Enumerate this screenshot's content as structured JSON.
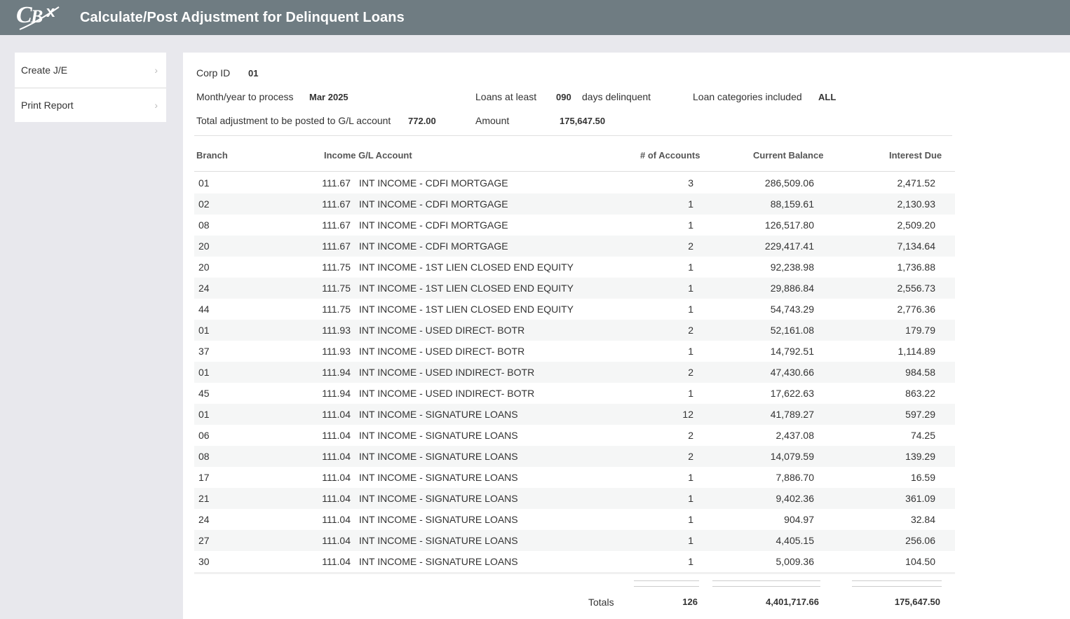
{
  "header": {
    "title": "Calculate/Post Adjustment for Delinquent Loans",
    "logo_icon": "cbx-logo"
  },
  "sidebar": {
    "items": [
      {
        "label": "Create J/E"
      },
      {
        "label": "Print Report"
      }
    ]
  },
  "info": {
    "corp_id_label": "Corp ID",
    "corp_id": "01",
    "month_label": "Month/year to process",
    "month": "Mar 2025",
    "loans_label": "Loans at least",
    "loans_days": "090",
    "days_label": "days delinquent",
    "categories_label": "Loan categories included",
    "categories": "ALL",
    "total_adj_label": "Total adjustment to be posted to G/L account",
    "total_adj": "772.00",
    "amount_label": "Amount",
    "amount": "175,647.50"
  },
  "table": {
    "headers": {
      "branch": "Branch",
      "gl": "Income G/L Account",
      "accounts": "# of Accounts",
      "balance": "Current Balance",
      "interest": "Interest Due"
    },
    "rows": [
      {
        "branch": "01",
        "gl": "111.67",
        "desc": "INT INCOME - CDFI MORTGAGE",
        "accounts": "3",
        "balance": "286,509.06",
        "interest": "2,471.52"
      },
      {
        "branch": "02",
        "gl": "111.67",
        "desc": "INT INCOME - CDFI MORTGAGE",
        "accounts": "1",
        "balance": "88,159.61",
        "interest": "2,130.93"
      },
      {
        "branch": "08",
        "gl": "111.67",
        "desc": "INT INCOME - CDFI MORTGAGE",
        "accounts": "1",
        "balance": "126,517.80",
        "interest": "2,509.20"
      },
      {
        "branch": "20",
        "gl": "111.67",
        "desc": "INT INCOME - CDFI MORTGAGE",
        "accounts": "2",
        "balance": "229,417.41",
        "interest": "7,134.64"
      },
      {
        "branch": "20",
        "gl": "111.75",
        "desc": "INT INCOME - 1ST LIEN CLOSED END EQUITY",
        "accounts": "1",
        "balance": "92,238.98",
        "interest": "1,736.88"
      },
      {
        "branch": "24",
        "gl": "111.75",
        "desc": "INT INCOME - 1ST LIEN CLOSED END EQUITY",
        "accounts": "1",
        "balance": "29,886.84",
        "interest": "2,556.73"
      },
      {
        "branch": "44",
        "gl": "111.75",
        "desc": "INT INCOME - 1ST LIEN CLOSED END EQUITY",
        "accounts": "1",
        "balance": "54,743.29",
        "interest": "2,776.36"
      },
      {
        "branch": "01",
        "gl": "111.93",
        "desc": "INT INCOME - USED DIRECT- BOTR",
        "accounts": "2",
        "balance": "52,161.08",
        "interest": "179.79"
      },
      {
        "branch": "37",
        "gl": "111.93",
        "desc": "INT INCOME - USED DIRECT- BOTR",
        "accounts": "1",
        "balance": "14,792.51",
        "interest": "1,114.89"
      },
      {
        "branch": "01",
        "gl": "111.94",
        "desc": "INT INCOME - USED INDIRECT- BOTR",
        "accounts": "2",
        "balance": "47,430.66",
        "interest": "984.58"
      },
      {
        "branch": "45",
        "gl": "111.94",
        "desc": "INT INCOME - USED INDIRECT- BOTR",
        "accounts": "1",
        "balance": "17,622.63",
        "interest": "863.22"
      },
      {
        "branch": "01",
        "gl": "111.04",
        "desc": "INT INCOME - SIGNATURE LOANS",
        "accounts": "12",
        "balance": "41,789.27",
        "interest": "597.29"
      },
      {
        "branch": "06",
        "gl": "111.04",
        "desc": "INT INCOME - SIGNATURE LOANS",
        "accounts": "2",
        "balance": "2,437.08",
        "interest": "74.25"
      },
      {
        "branch": "08",
        "gl": "111.04",
        "desc": "INT INCOME - SIGNATURE LOANS",
        "accounts": "2",
        "balance": "14,079.59",
        "interest": "139.29"
      },
      {
        "branch": "17",
        "gl": "111.04",
        "desc": "INT INCOME - SIGNATURE LOANS",
        "accounts": "1",
        "balance": "7,886.70",
        "interest": "16.59"
      },
      {
        "branch": "21",
        "gl": "111.04",
        "desc": "INT INCOME - SIGNATURE LOANS",
        "accounts": "1",
        "balance": "9,402.36",
        "interest": "361.09"
      },
      {
        "branch": "24",
        "gl": "111.04",
        "desc": "INT INCOME - SIGNATURE LOANS",
        "accounts": "1",
        "balance": "904.97",
        "interest": "32.84"
      },
      {
        "branch": "27",
        "gl": "111.04",
        "desc": "INT INCOME - SIGNATURE LOANS",
        "accounts": "1",
        "balance": "4,405.15",
        "interest": "256.06"
      },
      {
        "branch": "30",
        "gl": "111.04",
        "desc": "INT INCOME - SIGNATURE LOANS",
        "accounts": "1",
        "balance": "5,009.36",
        "interest": "104.50"
      }
    ],
    "totals": {
      "label": "Totals",
      "accounts": "126",
      "balance": "4,401,717.66",
      "interest": "175,647.50"
    }
  }
}
